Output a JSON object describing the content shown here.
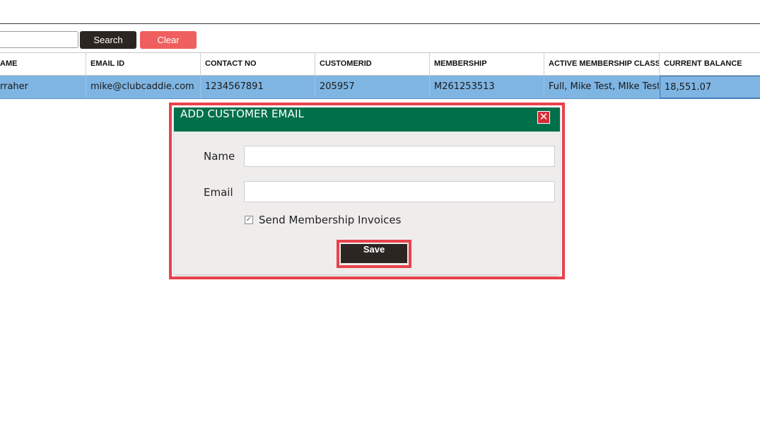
{
  "search": {
    "button_label": "Search",
    "clear_label": "Clear",
    "value": ""
  },
  "grid": {
    "columns": [
      "AME",
      "EMAIL ID",
      "CONTACT NO",
      "CUSTOMERID",
      "MEMBERSHIP",
      "ACTIVE MEMBERSHIP CLASSE",
      "CURRENT BALANCE"
    ],
    "rows": [
      [
        "rraher",
        "mike@clubcaddie.com",
        "1234567891",
        "205957",
        "M261253513",
        "Full, Mike Test, MIke Test",
        "18,551.07"
      ]
    ]
  },
  "dialog": {
    "title": "ADD CUSTOMER EMAIL",
    "close_glyph": "✕",
    "name_label": "Name",
    "name_value": "",
    "email_label": "Email",
    "email_value": "",
    "checkbox_label": "Send Membership Invoices",
    "checkbox_checked": true,
    "checkbox_glyph": "✓",
    "save_label": "Save"
  },
  "colors": {
    "dialog_header": "#00704a",
    "highlight": "#e8424c",
    "selected_row": "#7fb5e2",
    "clear_button": "#ef5f5f",
    "dark_button": "#2b2622"
  }
}
